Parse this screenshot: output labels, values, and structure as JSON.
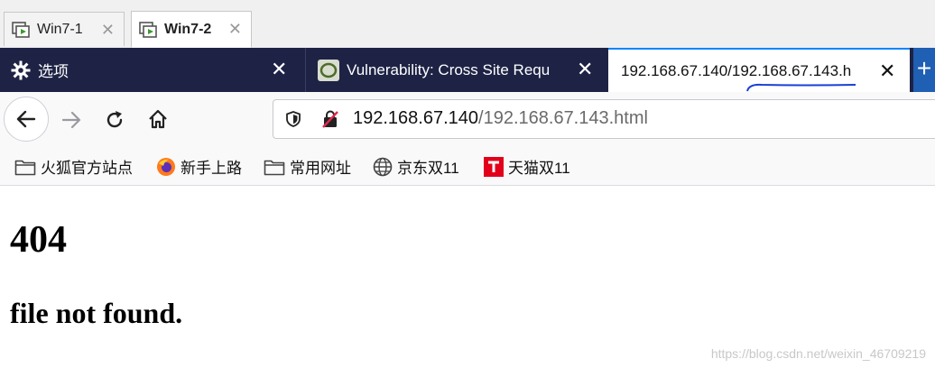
{
  "vm_tabs": [
    {
      "label": "Win7-1",
      "icon": "vm-icon",
      "active": false
    },
    {
      "label": "Win7-2",
      "icon": "vm-icon",
      "active": true
    }
  ],
  "browser_tabs": [
    {
      "label": "选项",
      "icon": "gear-icon"
    },
    {
      "label": "Vulnerability: Cross Site Requ",
      "icon": "dvwa-icon"
    },
    {
      "label": "192.168.67.140/192.168.67.143.h",
      "active": true
    }
  ],
  "url": {
    "host": "192.168.67.140",
    "path": "/192.168.67.143.html"
  },
  "bookmarks": [
    {
      "label": "火狐官方站点",
      "icon": "folder-icon"
    },
    {
      "label": "新手上路",
      "icon": "firefox-icon"
    },
    {
      "label": "常用网址",
      "icon": "folder-icon"
    },
    {
      "label": "京东双11",
      "icon": "globe-icon"
    },
    {
      "label": "天猫双11",
      "icon": "tmall-icon"
    }
  ],
  "page": {
    "heading": "404",
    "message": "file not found."
  },
  "watermark": "https://blog.csdn.net/weixin_46709219",
  "colors": {
    "tab_bar": "#1e2345",
    "accent": "#0a84ff",
    "annotation": "#1a3fd6",
    "tmall_red": "#e2001a"
  }
}
